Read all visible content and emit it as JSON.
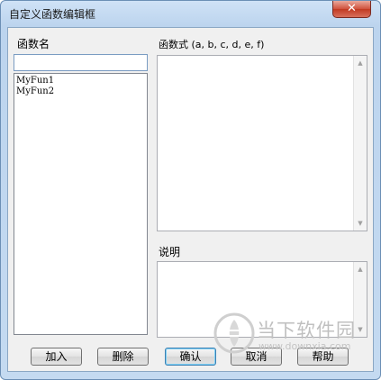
{
  "window": {
    "title": "自定义函数编辑框",
    "close_glyph": "✕"
  },
  "labels": {
    "function_name": "函数名",
    "expression": "函数式 (a, b, c, d, e, f)",
    "description": "说明"
  },
  "name_input": {
    "value": ""
  },
  "function_list": {
    "items": [
      "MyFun1",
      "MyFun2"
    ]
  },
  "expression_box": {
    "value": ""
  },
  "description_box": {
    "value": ""
  },
  "buttons": {
    "add": "加入",
    "delete": "删除",
    "ok": "确认",
    "cancel": "取消",
    "help": "帮助"
  },
  "watermark": {
    "text": "当下软件园",
    "url": "www.downxia.com"
  },
  "colors": {
    "title_bar": "#bcd4ee",
    "close_button": "#c13a22",
    "client_bg": "#f0f0f0",
    "default_button_border": "#3c7fb1"
  }
}
